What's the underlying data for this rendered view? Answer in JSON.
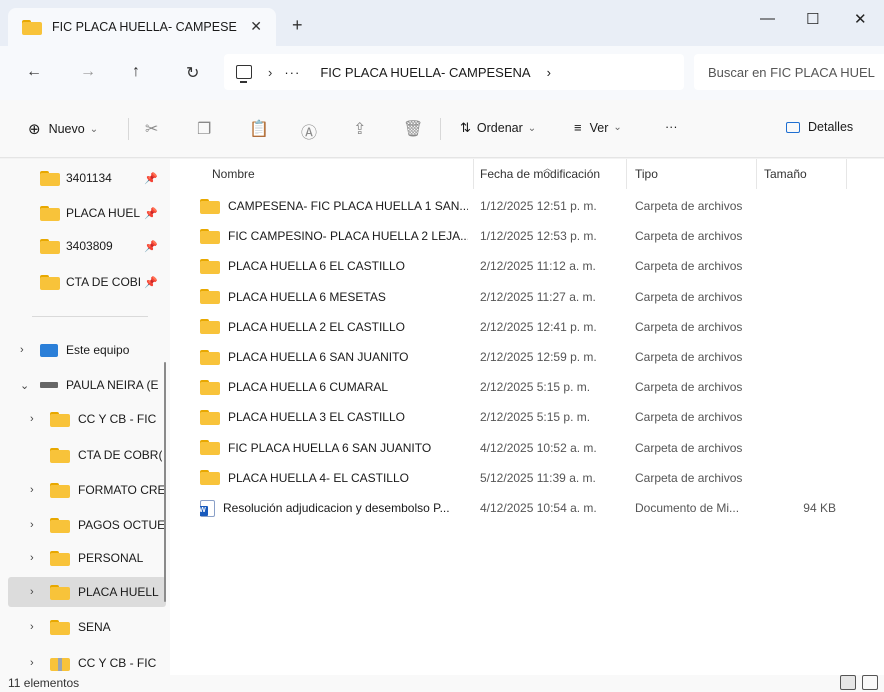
{
  "tab": {
    "title": "FIC PLACA HUELLA- CAMPESE",
    "close_glyph": "✕",
    "new_glyph": "+"
  },
  "window": {
    "minimize": "—",
    "maximize": "☐",
    "close": "✕"
  },
  "nav": {
    "back": "←",
    "forward": "→",
    "up": "↑",
    "refresh": "↻"
  },
  "address": {
    "separator": "›",
    "more": "···",
    "crumb": "FIC PLACA HUELLA- CAMPESENA",
    "trailing": "›",
    "search_placeholder": "Buscar en FIC PLACA HUEL"
  },
  "toolbar": {
    "new_label": "Nuevo",
    "sort_label": "Ordenar",
    "view_label": "Ver",
    "more": "···",
    "details_label": "Detalles",
    "chevron": "⌄"
  },
  "sidebar": {
    "pinned": [
      {
        "label": "3401134",
        "pin": "📌"
      },
      {
        "label": "PLACA HUEL",
        "pin": "📌"
      },
      {
        "label": "3403809",
        "pin": "📌"
      },
      {
        "label": "CTA DE COBI",
        "pin": "📌"
      }
    ],
    "tree": [
      {
        "label": "Este equipo",
        "chev": "›"
      },
      {
        "label": "PAULA NEIRA (E",
        "chev": "⌄"
      },
      {
        "label": "CC Y CB - FIC",
        "chev": "›"
      },
      {
        "label": "CTA DE COBR(",
        "chev": ""
      },
      {
        "label": "FORMATO CRE",
        "chev": "›"
      },
      {
        "label": "PAGOS OCTUE",
        "chev": "›"
      },
      {
        "label": "PERSONAL",
        "chev": "›"
      },
      {
        "label": "PLACA HUELL",
        "chev": "›"
      },
      {
        "label": "SENA",
        "chev": "›"
      },
      {
        "label": "CC Y CB - FIC",
        "chev": "›"
      }
    ]
  },
  "columns": {
    "name": "Nombre",
    "date": "Fecha de modificación",
    "type": "Tipo",
    "size": "Tamaño"
  },
  "files": [
    {
      "name": "CAMPESENA- FIC PLACA HUELLA 1 SAN...",
      "date": "1/12/2025 12:51 p. m.",
      "type": "Carpeta de archivos",
      "size": "",
      "icon": "folder"
    },
    {
      "name": "FIC CAMPESINO- PLACA HUELLA 2 LEJA...",
      "date": "1/12/2025 12:53 p. m.",
      "type": "Carpeta de archivos",
      "size": "",
      "icon": "folder"
    },
    {
      "name": "PLACA HUELLA 6 EL CASTILLO",
      "date": "2/12/2025 11:12 a. m.",
      "type": "Carpeta de archivos",
      "size": "",
      "icon": "folder"
    },
    {
      "name": "PLACA HUELLA 6 MESETAS",
      "date": "2/12/2025 11:27 a. m.",
      "type": "Carpeta de archivos",
      "size": "",
      "icon": "folder"
    },
    {
      "name": "PLACA HUELLA 2 EL CASTILLO",
      "date": "2/12/2025 12:41 p. m.",
      "type": "Carpeta de archivos",
      "size": "",
      "icon": "folder"
    },
    {
      "name": "PLACA HUELLA 6 SAN JUANITO",
      "date": "2/12/2025 12:59 p. m.",
      "type": "Carpeta de archivos",
      "size": "",
      "icon": "folder"
    },
    {
      "name": "PLACA HUELLA 6 CUMARAL",
      "date": "2/12/2025 5:15 p. m.",
      "type": "Carpeta de archivos",
      "size": "",
      "icon": "folder"
    },
    {
      "name": "PLACA HUELLA 3 EL CASTILLO",
      "date": "2/12/2025 5:15 p. m.",
      "type": "Carpeta de archivos",
      "size": "",
      "icon": "folder"
    },
    {
      "name": "FIC PLACA HUELLA 6 SAN JUANITO",
      "date": "4/12/2025 10:52 a. m.",
      "type": "Carpeta de archivos",
      "size": "",
      "icon": "folder"
    },
    {
      "name": "PLACA HUELLA 4- EL CASTILLO",
      "date": "5/12/2025 11:39 a. m.",
      "type": "Carpeta de archivos",
      "size": "",
      "icon": "folder"
    },
    {
      "name": "Resolución adjudicacion y desembolso P...",
      "date": "4/12/2025 10:54 a. m.",
      "type": "Documento de Mi...",
      "size": "94 KB",
      "icon": "word"
    }
  ],
  "status": {
    "count": "11 elementos"
  }
}
